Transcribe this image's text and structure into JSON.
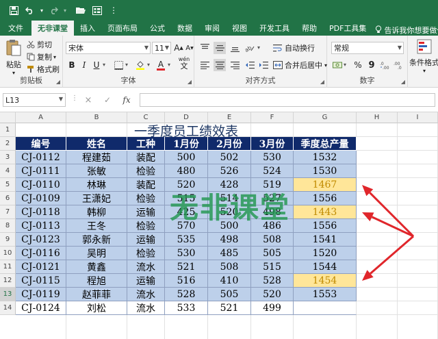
{
  "quick_access": {
    "save_icon": "save-icon",
    "undo_icon": "undo-icon",
    "redo_icon": "redo-icon",
    "open_icon": "folder-open-icon",
    "form_icon": "form-icon",
    "customize_icon": "customize-icon"
  },
  "tabs": [
    "文件",
    "无非课堂",
    "插入",
    "页面布局",
    "公式",
    "数据",
    "审阅",
    "视图",
    "开发工具",
    "帮助",
    "PDF工具集"
  ],
  "active_tab": 1,
  "tell_me": "告诉我你想要做什么",
  "ribbon": {
    "clipboard": {
      "label": "剪贴板",
      "paste": "粘贴",
      "cut": "剪切",
      "copy": "复制",
      "format_painter": "格式刷"
    },
    "font": {
      "label": "字体",
      "font_name": "宋体",
      "font_size": "11",
      "bold": "B",
      "italic": "I",
      "underline": "U",
      "grow": "A",
      "shrink": "A",
      "color_a": "A",
      "wen": "wén"
    },
    "alignment": {
      "label": "对齐方式",
      "wrap": "自动换行",
      "merge": "合并后居中"
    },
    "number": {
      "label": "数字",
      "format": "常规",
      "percent": "%",
      "comma": "9"
    },
    "styles": {
      "conditional": "条件格式"
    }
  },
  "formula_bar": {
    "name_box": "L13",
    "cancel": "×",
    "confirm": "✓",
    "fx": "fx",
    "value": ""
  },
  "columns": [
    "A",
    "B",
    "C",
    "D",
    "E",
    "F",
    "G",
    "H",
    "I"
  ],
  "rows": [
    "1",
    "2",
    "3",
    "4",
    "5",
    "6",
    "7",
    "8",
    "9",
    "10",
    "11",
    "12",
    "13",
    "14"
  ],
  "sheet": {
    "title": "一季度员工绩效表",
    "headers": [
      "编号",
      "姓名",
      "工种",
      "1月份",
      "2月份",
      "3月份",
      "季度总产量"
    ],
    "data": [
      [
        "CJ-0112",
        "程建茹",
        "装配",
        "500",
        "502",
        "530",
        "1532"
      ],
      [
        "CJ-0111",
        "张敏",
        "检验",
        "480",
        "526",
        "524",
        "1530"
      ],
      [
        "CJ-0110",
        "林琳",
        "装配",
        "520",
        "428",
        "519",
        "1467"
      ],
      [
        "CJ-0109",
        "王潇妃",
        "检验",
        "515",
        "514",
        "527",
        "1556"
      ],
      [
        "CJ-0118",
        "韩柳",
        "运输",
        "425",
        "520",
        "498",
        "1443"
      ],
      [
        "CJ-0113",
        "王冬",
        "检验",
        "570",
        "500",
        "486",
        "1556"
      ],
      [
        "CJ-0123",
        "郭永新",
        "运输",
        "535",
        "498",
        "508",
        "1541"
      ],
      [
        "CJ-0116",
        "吴明",
        "检验",
        "530",
        "485",
        "505",
        "1520"
      ],
      [
        "CJ-0121",
        "黄鑫",
        "流水",
        "521",
        "508",
        "515",
        "1544"
      ],
      [
        "CJ-0115",
        "程旭",
        "运输",
        "516",
        "410",
        "528",
        "1454"
      ],
      [
        "CJ-0119",
        "赵菲菲",
        "流水",
        "528",
        "505",
        "520",
        "1553"
      ],
      [
        "CJ-0124",
        "刘松",
        "流水",
        "533",
        "521",
        "499",
        ""
      ]
    ],
    "highlighted_rows": [
      2,
      4,
      9
    ]
  },
  "colors": {
    "excel_green": "#217346",
    "header_fill": "#102a6b",
    "cell_fill": "#bdd0ea",
    "highlight_fill": "#ffe699",
    "highlight_text": "#c08a00",
    "arrow_red": "#e0262b"
  },
  "watermark": "无非课堂"
}
